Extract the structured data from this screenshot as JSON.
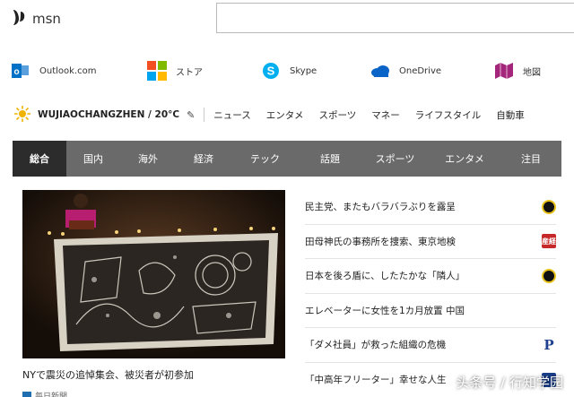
{
  "header": {
    "logo_text": "msn",
    "search": {
      "value": "",
      "placeholder": ""
    }
  },
  "apps": [
    {
      "label": "Outlook.com",
      "icon": "outlook-icon",
      "color": "#0072c6"
    },
    {
      "label": "ストア",
      "icon": "store-icon",
      "color": "#f25022"
    },
    {
      "label": "Skype",
      "icon": "skype-icon",
      "color": "#00aff0"
    },
    {
      "label": "OneDrive",
      "icon": "onedrive-icon",
      "color": "#0a64c8"
    },
    {
      "label": "地図",
      "icon": "maps-icon",
      "color": "#a4267b"
    }
  ],
  "weather": {
    "location": "WUJIAOCHANGZHEN / 20°C",
    "icon": "sun-icon",
    "edit_icon": "pencil-icon"
  },
  "nav_links": [
    "ニュース",
    "エンタメ",
    "スポーツ",
    "マネー",
    "ライフスタイル",
    "自動車"
  ],
  "tabs": [
    "総合",
    "国内",
    "海外",
    "経済",
    "テック",
    "話題",
    "スポーツ",
    "エンタメ",
    "注目"
  ],
  "active_tab": "総合",
  "hero": {
    "caption": "NYで震災の追悼集会、被災者が初参加",
    "source": "毎日新聞"
  },
  "news": [
    {
      "title": "民主党、またもバラバラぶりを露呈",
      "source_icon": "yomiuri-logo-icon"
    },
    {
      "title": "田母神氏の事務所を捜索、東京地検",
      "source_icon": "sankei-logo-icon",
      "source_text": "産経"
    },
    {
      "title": "日本を後ろ盾に、したたかな「隣人」",
      "source_icon": "yomiuri-logo-icon"
    },
    {
      "title": "エレベーターに女性を1カ月放置 中国",
      "source_icon": ""
    },
    {
      "title": "「ダメ社員」が救った組織の危機",
      "source_icon": "president-logo-icon",
      "source_text": "P"
    },
    {
      "title": "「中高年フリーター」幸せな人生",
      "source_icon": "diamond-logo-icon"
    }
  ],
  "watermark": "头条号 / 行知学园",
  "colors": {
    "tab_bar": "#6a6a6a",
    "tab_active": "#2c2c2c"
  }
}
